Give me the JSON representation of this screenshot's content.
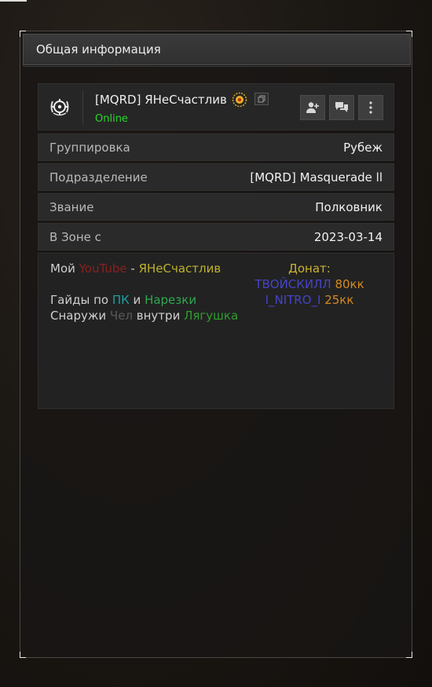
{
  "panel": {
    "title": "Общая информация"
  },
  "profile": {
    "name": "[MQRD] ЯНеСчастлив",
    "status": "Online",
    "status_color": "#29d829",
    "emblem_icon": "crosshair-wreath-icon",
    "rank_icon": "sun-badge-icon",
    "copy_icon": "copy-icon",
    "actions": {
      "add_friend_icon": "add-friend-icon",
      "message_icon": "chat-icon",
      "more_icon": "more-vertical-icon"
    }
  },
  "info": [
    {
      "label": "Группировка",
      "value": "Рубеж"
    },
    {
      "label": "Подразделение",
      "value": "[MQRD] Masquerade ll"
    },
    {
      "label": "Звание",
      "value": "Полковник"
    },
    {
      "label": "В Зоне с",
      "value": "2023-03-14"
    }
  ],
  "bio": {
    "line1": {
      "a": "Мой ",
      "b": "YouTube",
      "c": " - ",
      "d": "ЯНеСчастлив"
    },
    "line2": {
      "a": "Гайды по ",
      "b": "ПК",
      "c": " и ",
      "d": "Нарезки"
    },
    "line3": {
      "a": "Снаружи ",
      "b": "Чел",
      "c": " внутри ",
      "d": "Лягушка"
    },
    "donate_title": "Донат:",
    "donate1": {
      "name": "ТВОЙСКИЛЛ",
      "amount": " 80кк"
    },
    "donate2": {
      "name": "I_NITRO_I",
      "amount": " 25кк"
    }
  }
}
